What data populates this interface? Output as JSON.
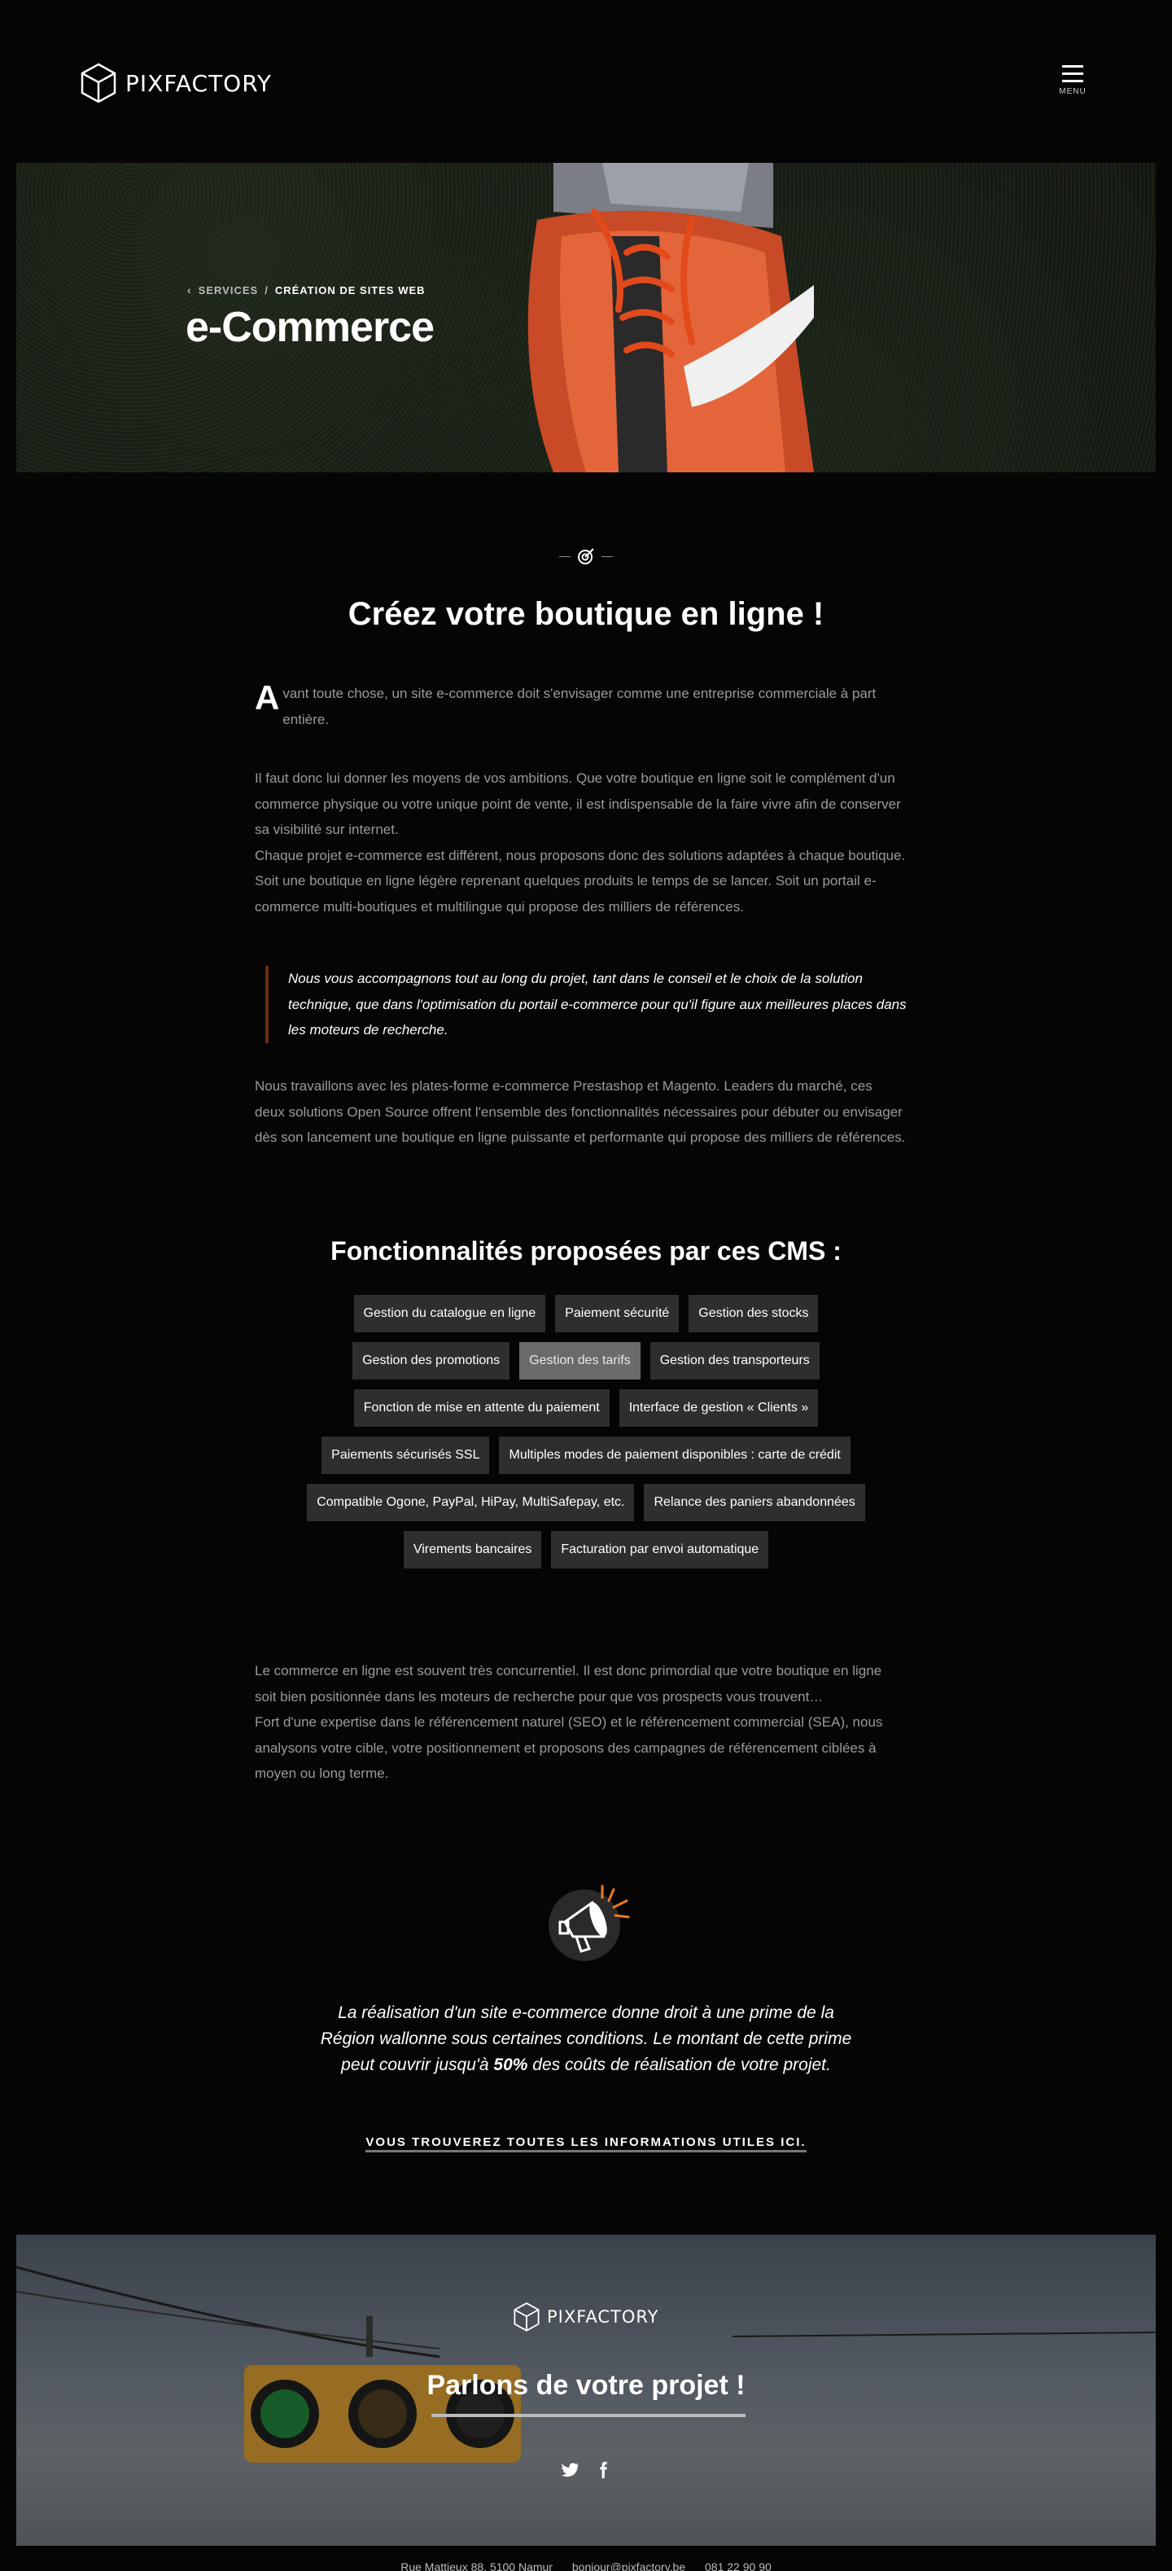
{
  "header": {
    "logo_text": "PIXFACTORY",
    "menu_label": "MENU"
  },
  "hero": {
    "breadcrumb_parent": "SERVICES",
    "breadcrumb_sep": "/",
    "breadcrumb_current": "CRÉATION DE SITES WEB",
    "title": "e-Commerce"
  },
  "main": {
    "title": "Créez votre boutique en ligne !",
    "intro_drop": "A",
    "intro_rest": "vant toute chose, un site e-commerce doit  s'envisager comme une entreprise commerciale à part entière.",
    "para2": "Il faut donc lui donner les moyens de vos ambitions. Que votre boutique en ligne soit le complément d'un commerce physique ou votre unique point de vente, il est indispensable de la faire vivre afin de conserver sa visibilité sur internet.",
    "para3": "Chaque projet e-commerce est différent, nous proposons donc des solutions adaptées à chaque boutique. Soit une boutique en ligne légère reprenant quelques produits le temps de se lancer. Soit un portail e-commerce multi-boutiques et multilingue qui propose des milliers de références.",
    "quote": "Nous vous accompagnons tout au long du projet, tant dans le conseil et le choix de la solution technique, que dans l'optimisation du portail e-commerce pour qu'il figure aux meilleures places dans les moteurs de recherche.",
    "para4": "Nous travaillons avec les plates-forme e-commerce Prestashop et Magento. Leaders du marché, ces deux solutions Open Source offrent l'ensemble des fonctionnalités nécessaires pour débuter ou envisager dès son lancement une boutique en ligne puissante et performante qui propose des milliers de références.",
    "cms_title": "Fonctionnalités proposées par ces CMS :",
    "tags": [
      "Gestion du catalogue en ligne",
      "Paiement sécurité",
      "Gestion des stocks",
      "Gestion des promotions",
      "Gestion des tarifs",
      "Gestion des transporteurs",
      "Fonction de mise en attente du paiement",
      "Interface de gestion « Clients »",
      "Paiements sécurisés SSL",
      "Multiples modes de paiement disponibles : carte de crédit",
      "Compatible Ogone, PayPal, HiPay, MultiSafepay, etc.",
      "Relance des paniers abandonnées",
      "Virements bancaires",
      "Facturation par envoi automatique"
    ],
    "para5": "Le commerce en ligne est souvent très concurrentiel. Il est donc primordial que votre boutique en ligne soit bien positionnée dans les moteurs de recherche pour que vos prospects vous trouvent…",
    "para6": "Fort d'une expertise dans le référencement naturel (SEO) et le référencement commercial (SEA), nous analysons votre cible, votre positionnement et proposons des campagnes de référencement ciblées à moyen ou long terme.",
    "prime_before": "La réalisation d'un site e-commerce donne droit à une prime de la Région wallonne sous certaines conditions. Le montant de cette prime peut couvrir jusqu'à ",
    "prime_bold": "50%",
    "prime_after": " des coûts de réalisation de votre projet.",
    "info_link": "VOUS TROUVEREZ TOUTES LES INFORMATIONS UTILES ICI."
  },
  "cta": {
    "logo_text": "PIXFACTORY",
    "title": "Parlons de votre projet !"
  },
  "footer": {
    "address": "Rue Mattieux 88, 5100 Namur",
    "email": "bonjour@pixfactory.be",
    "phone": "081 22 90 90"
  },
  "colors": {
    "background": "#050505",
    "accent_quote_border": "#6a2c0e",
    "tag_bg": "#2e2e2e",
    "tag_active_bg": "#6a6a6a",
    "megaphone_accent": "#f07a1a"
  }
}
